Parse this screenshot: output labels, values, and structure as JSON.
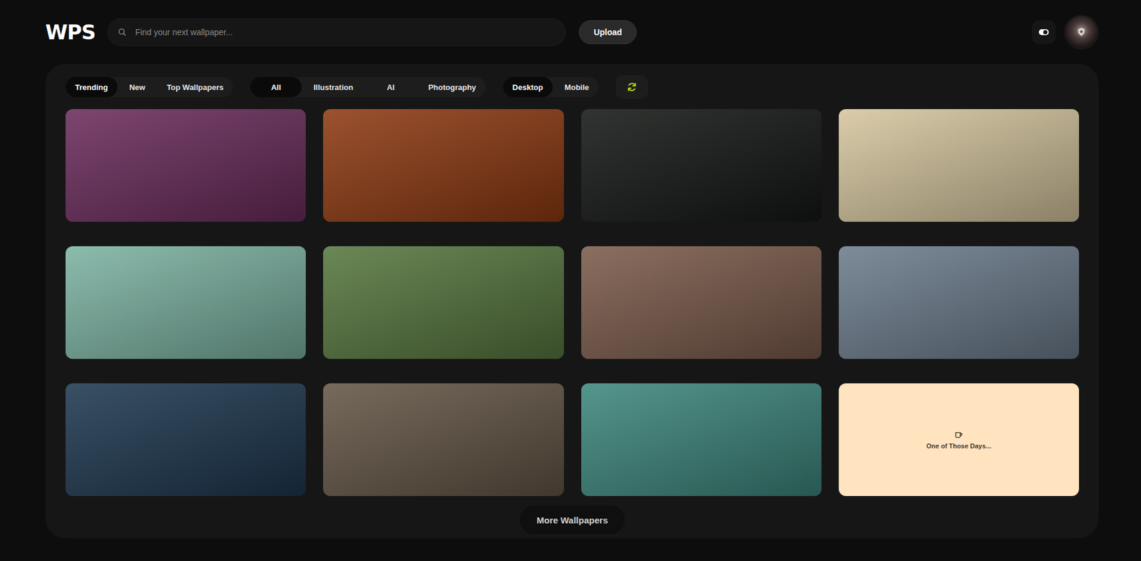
{
  "logo": "WPS",
  "search": {
    "placeholder": "Find your next wallpaper..."
  },
  "upload_button": "Upload",
  "sort_tabs": [
    {
      "label": "Trending",
      "selected": true
    },
    {
      "label": "New",
      "selected": false
    },
    {
      "label": "Top Wallpapers",
      "selected": false
    }
  ],
  "category_tabs": [
    {
      "label": "All",
      "selected": true
    },
    {
      "label": "Illustration",
      "selected": false
    },
    {
      "label": "AI",
      "selected": false
    },
    {
      "label": "Photography",
      "selected": false
    }
  ],
  "device_tabs": [
    {
      "label": "Desktop",
      "selected": true
    },
    {
      "label": "Mobile",
      "selected": false
    }
  ],
  "wallpapers": [
    {
      "kind": "image",
      "color": "#6b2c5c"
    },
    {
      "kind": "image",
      "color": "#8e3a12"
    },
    {
      "kind": "image",
      "color": "#141815"
    },
    {
      "kind": "image",
      "color": "#d6c69f"
    },
    {
      "kind": "image",
      "color": "#7cb3a2"
    },
    {
      "kind": "image",
      "color": "#57773f"
    },
    {
      "kind": "image",
      "color": "#7b5b4b"
    },
    {
      "kind": "image",
      "color": "#6c7c8c"
    },
    {
      "kind": "image",
      "color": "#1e3850"
    },
    {
      "kind": "image",
      "color": "#645646"
    },
    {
      "kind": "image",
      "color": "#3d877d"
    },
    {
      "kind": "placeholder",
      "color": "#ffe4bf",
      "caption": "One of Those Days..."
    }
  ],
  "more_button": "More Wallpapers"
}
